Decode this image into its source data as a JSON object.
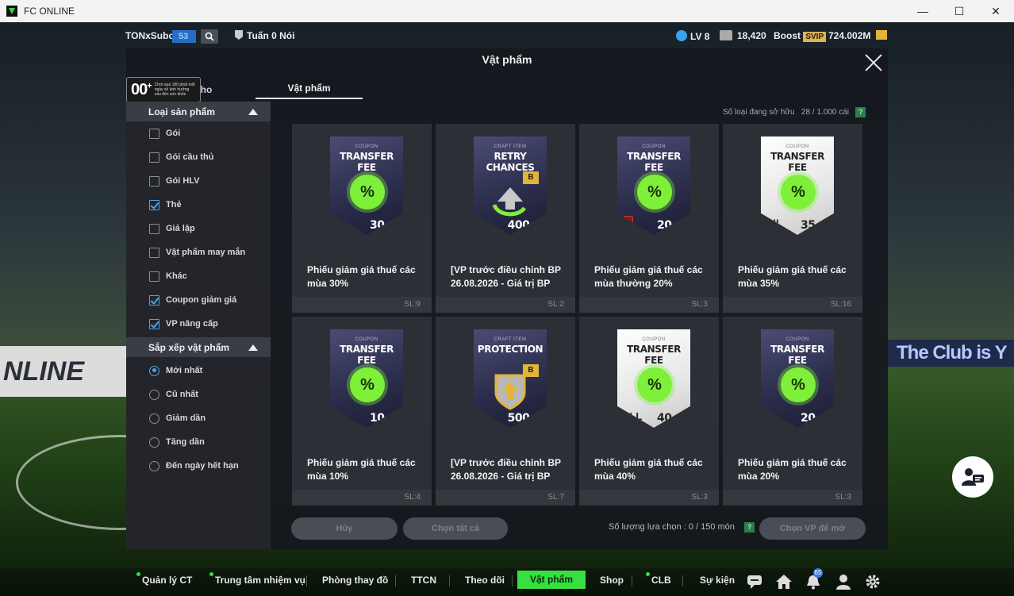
{
  "window": {
    "title": "FC ONLINE",
    "minimize_glyph": "—",
    "maximize_glyph": "☐",
    "close_glyph": "✕"
  },
  "background": {
    "board_right": "The Club is Y",
    "board_left": "NLINE"
  },
  "hud": {
    "username": "TONxSubo",
    "user_badge": "53",
    "team_name": "Tuấn 0 Nói",
    "level": "LV 8",
    "coins": "18,420",
    "boost_label": "Boost",
    "vip_label": "SVIP",
    "bp": "724.002M"
  },
  "panel": {
    "title": "Vật phẩm",
    "timer_big": "00",
    "timer_sup": "+",
    "timer_note": "Chơi quá 180 phút một ngày sẽ ảnh hưởng xấu đến sức khỏe",
    "tab_kho": "Kho",
    "tab_vatpham": "Vật phẩm",
    "owned_label": "Số loại đang sở hữu",
    "owned_value": "28 / 1.000 cái",
    "help_glyph": "?"
  },
  "sidebar": {
    "filter_head": "Loại sản phẩm",
    "filters": [
      {
        "label": "Gói",
        "checked": false
      },
      {
        "label": "Gói cầu thủ",
        "checked": false
      },
      {
        "label": "Gói HLV",
        "checked": false
      },
      {
        "label": "Thẻ",
        "checked": true
      },
      {
        "label": "Giả lập",
        "checked": false
      },
      {
        "label": "Vật phẩm may mắn",
        "checked": false
      },
      {
        "label": "Khác",
        "checked": false
      },
      {
        "label": "Coupon giảm giá",
        "checked": true
      },
      {
        "label": "VP nâng cấp",
        "checked": true
      }
    ],
    "sort_head": "Sắp xếp vật phẩm",
    "sorts": [
      {
        "label": "Mới nhất",
        "selected": true
      },
      {
        "label": "Cũ nhất",
        "selected": false
      },
      {
        "label": "Giảm dần",
        "selected": false
      },
      {
        "label": "Tăng dần",
        "selected": false
      },
      {
        "label": "Đến ngày hết hạn",
        "selected": false
      }
    ]
  },
  "items": [
    {
      "name": "Phiếu giảm giá thuế các mùa 30%",
      "qty": "SL:9",
      "style": "dark",
      "sub": "COUPON",
      "hdr": "TRANSFER FEE",
      "pct": "30",
      "pct_unit": "%",
      "pct_sub": "DISCOUNT"
    },
    {
      "name": "[VP trước điều chỉnh BP 26.08.2026 - Giá trị BP",
      "qty": "SL:2",
      "style": "dark",
      "sub": "CRAFT ITEM",
      "hdr": "RETRY CHANCES",
      "pct": "400",
      "pct_unit": "B",
      "pct_sub": "MAX",
      "craft": "retry",
      "tag": "B"
    },
    {
      "name": "Phiếu giảm giá thuế các mùa thường 20%",
      "qty": "SL:3",
      "style": "dark",
      "sub": "COUPON",
      "hdr": "TRANSFER FEE",
      "pct": "20",
      "pct_unit": "%",
      "pct_sub": "DISCOUNT",
      "lock": true
    },
    {
      "name": "Phiếu giảm giá thuế các mùa 35%",
      "qty": "SL:16",
      "style": "light",
      "sub": "COUPON",
      "hdr": "TRANSFER FEE",
      "pct": "35",
      "pct_unit": "%",
      "pct_sub": "BONUS",
      "allc": "All",
      "allc_sub": "CLASS RGB2"
    },
    {
      "name": "Phiếu giảm giá thuế các mùa 10%",
      "qty": "SL:4",
      "style": "dark",
      "sub": "COUPON",
      "hdr": "TRANSFER FEE",
      "pct": "10",
      "pct_unit": "%",
      "pct_sub": "DISCOUNT"
    },
    {
      "name": "[VP trước điều chỉnh BP 26.08.2026 - Giá trị BP",
      "qty": "SL:7",
      "style": "dark",
      "sub": "CRAFT ITEM",
      "hdr": "PROTECTION",
      "pct": "500",
      "pct_unit": "B",
      "pct_sub": "MAX",
      "craft": "protect",
      "tag": "B"
    },
    {
      "name": "Phiếu giảm giá thuế các mùa 40%",
      "qty": "SL:3",
      "style": "light",
      "sub": "COUPON",
      "hdr": "TRANSFER FEE",
      "pct": "40",
      "pct_unit": "%",
      "pct_sub": "BONUS",
      "allc": "ALL",
      "allc_sub": "CLASS SEASON"
    },
    {
      "name": "Phiếu giảm giá thuế các mùa 20%",
      "qty": "SL:3",
      "style": "dark",
      "sub": "COUPON",
      "hdr": "TRANSFER FEE",
      "pct": "20",
      "pct_unit": "%",
      "pct_sub": "DISCOUNT"
    }
  ],
  "footer": {
    "cancel_label": "Hủy",
    "select_all_label": "Chọn tất cả",
    "selected_label": "Số lượng lựa chọn : 0 / 150 món",
    "exchange_label": "Chọn VP để mở"
  },
  "nav": {
    "items": [
      "Quản lý CT",
      "Trung tâm nhiệm vụ",
      "Phòng thay đồ",
      "TTCN",
      "Theo dõi",
      "Vật phẩm",
      "Shop",
      "CLB",
      "Sự kiện"
    ],
    "active": "Vật phẩm",
    "notif_count": "65"
  },
  "colors": {
    "accent_green": "#35e03f",
    "checkbox_blue": "#4aa3e8",
    "coupon_green": "#7ef03a"
  }
}
